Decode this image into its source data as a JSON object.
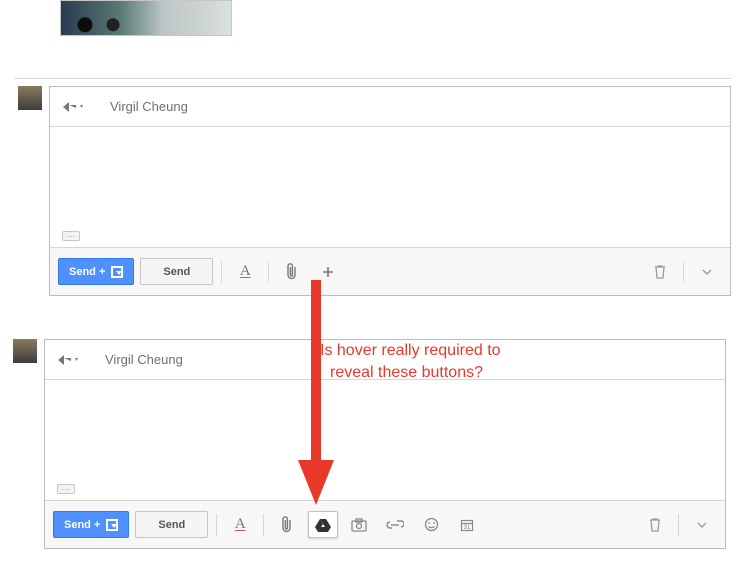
{
  "compose1": {
    "recipient": "Virgil Cheung",
    "ellipsis": "···",
    "send_archive": "Send +",
    "send": "Send"
  },
  "compose2": {
    "recipient": "Virgil Cheung",
    "ellipsis": "···",
    "send_archive": "Send +",
    "send": "Send"
  },
  "annotation": {
    "line1": "Is hover really required to",
    "line2": "reveal these buttons?"
  }
}
